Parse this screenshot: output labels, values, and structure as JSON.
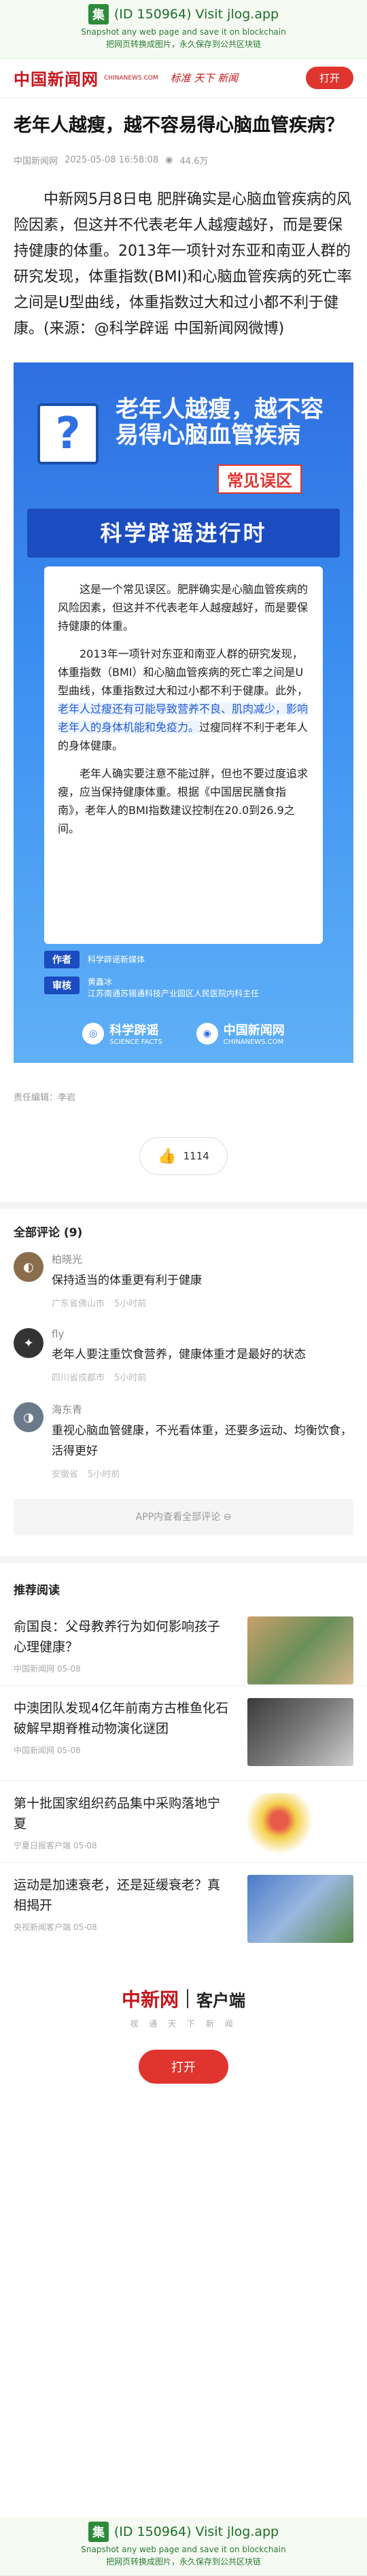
{
  "jlog": {
    "logo": "集",
    "id_text": "(ID 150964) Visit jlog.app",
    "line2": "Snapshot any web page and save it on blockchain",
    "line3": "把网页转换成图片，永久保存到公共区块链"
  },
  "header": {
    "brand": "中国新闻网",
    "brand_sub": "CHINANEWS.COM",
    "slogan": "标准 天下 新闻",
    "open_button": "打开"
  },
  "article": {
    "title": "老年人越瘦，越不容易得心脑血管疾病？",
    "source": "中国新闻网",
    "datetime": "2025-05-08 16:58:08",
    "views": "44.6万",
    "lead": "中新网5月8日电 肥胖确实是心脑血管疾病的风险因素，但这并不代表老年人越瘦越好，而是要保持健康的体重。2013年一项针对东亚和南亚人群的研究发现，体重指数(BMI)和心脑血管疾病的死亡率之间是U型曲线，体重指数过大和过小都不利于健康。(来源：@科学辟谣 中国新闻网微博)",
    "editor": "责任编辑：李岩",
    "likes": "1114"
  },
  "infographic": {
    "headline": "老年人越瘦，越不容易得心脑血管疾病",
    "tag": "常见误区",
    "ribbon": "科学辟谣进行时",
    "para1": "这是一个常见误区。肥胖确实是心脑血管疾病的风险因素，但这并不代表老年人越瘦越好，而是要保持健康的体重。",
    "para2a": "2013年一项针对东亚和南亚人群的研究发现，体重指数（BMI）和心脑血管疾病的死亡率之间是U型曲线，体重指数过大和过小都不利于健康。此外，",
    "para2_hl": "老年人过瘦还有可能导致营养不良、肌肉减少，影响老年人的身体机能和免疫力。",
    "para2b": "过瘦同样不利于老年人的身体健康。",
    "para3": "老年人确实要注意不能过胖，但也不要过度追求瘦，应当保持健康体重。根据《中国居民膳食指南》，老年人的BMI指数建议控制在20.0到26.9之间。",
    "author_label": "作者",
    "author_value": "科学辟谣新媒体",
    "reviewer_label": "审核",
    "reviewer_value": "黄鑫冰\n江苏南通苏锡通科技产业园区人民医院内科主任",
    "logo1": "科学辟谣",
    "logo1_sub": "SCIENCE FACTS",
    "logo2": "中国新闻网",
    "logo2_sub": "CHINANEWS.COM"
  },
  "comments": {
    "title": "全部评论 (9)",
    "items": [
      {
        "name": "柏晓光",
        "text": "保持适当的体重更有利于健康",
        "location": "广东省佛山市",
        "time": "5小时前"
      },
      {
        "name": "fly",
        "text": "老年人要注重饮食营养，健康体重才是最好的状态",
        "location": "四川省成都市",
        "time": "5小时前"
      },
      {
        "name": "海东青",
        "text": "重视心脑血管健康，不光看体重，还要多运动、均衡饮食，活得更好",
        "location": "安徽省",
        "time": "5小时前"
      }
    ],
    "more": "APP内查看全部评论 ⊖"
  },
  "recommended": {
    "title": "推荐阅读",
    "items": [
      {
        "headline": "俞国良：父母教养行为如何影响孩子心理健康？",
        "source": "中国新闻网 05-08"
      },
      {
        "headline": "中澳团队发现4亿年前南方古椎鱼化石 破解早期脊椎动物演化谜团",
        "source": "中国新闻网 05-08"
      },
      {
        "headline": "第十批国家组织药品集中采购落地宁夏",
        "source": "宁夏日报客户端 05-08"
      },
      {
        "headline": "运动是加速衰老，还是延缓衰老？真相揭开",
        "source": "央视新闻客户端 05-08"
      }
    ]
  },
  "footer": {
    "brand": "中新网",
    "client": "客户端",
    "slogan": "视 通 天 下 新 闻",
    "open_button": "打开"
  },
  "colors": {
    "brand_red": "#c4161c",
    "button_red": "#e0342e",
    "info_blue": "#2f6fe0"
  }
}
